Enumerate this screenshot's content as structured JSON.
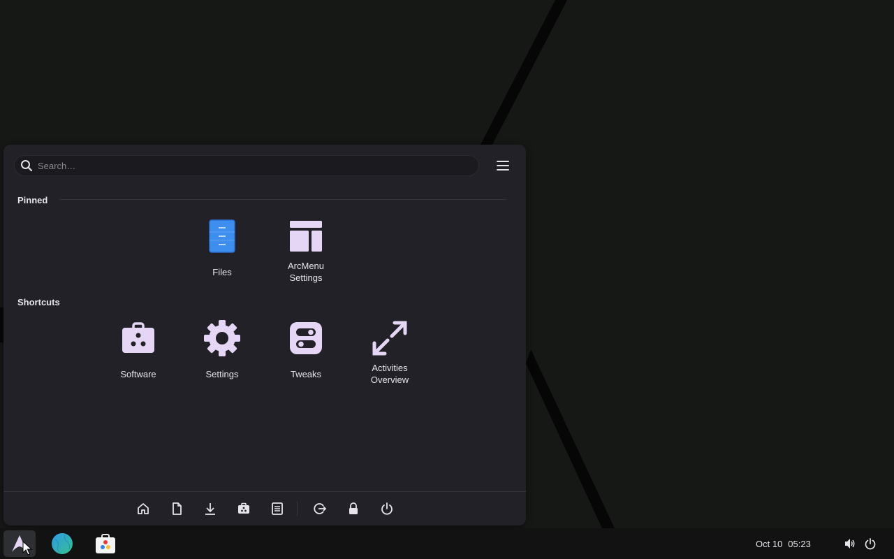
{
  "menu": {
    "search": {
      "placeholder": "Search…",
      "value": ""
    },
    "pinned": {
      "title": "Pinned",
      "apps": [
        {
          "label": "Files",
          "icon": "files-icon"
        },
        {
          "label": "ArcMenu\nSettings",
          "icon": "layout-icon"
        }
      ]
    },
    "shortcuts": {
      "title": "Shortcuts",
      "apps": [
        {
          "label": "Software",
          "icon": "software-bag-icon"
        },
        {
          "label": "Settings",
          "icon": "gear-icon"
        },
        {
          "label": "Tweaks",
          "icon": "toggles-icon"
        },
        {
          "label": "Activities\nOverview",
          "icon": "expand-arrows-icon"
        }
      ]
    },
    "footer": [
      "home-icon",
      "document-icon",
      "download-icon",
      "software-icon",
      "file-cabinet-icon",
      "log-out-icon",
      "lock-icon",
      "power-icon"
    ]
  },
  "taskbar": {
    "apps": [
      "arch-logo-icon",
      "browser-icon",
      "software-store-icon"
    ],
    "clock": {
      "date": "Oct 10",
      "time": "05:23"
    },
    "tray": [
      "volume-icon",
      "power-icon"
    ]
  },
  "colors": {
    "icon_tint": "#e4d6f4",
    "files_blue": "#3e8ef0",
    "menu_bg": "#232128"
  }
}
